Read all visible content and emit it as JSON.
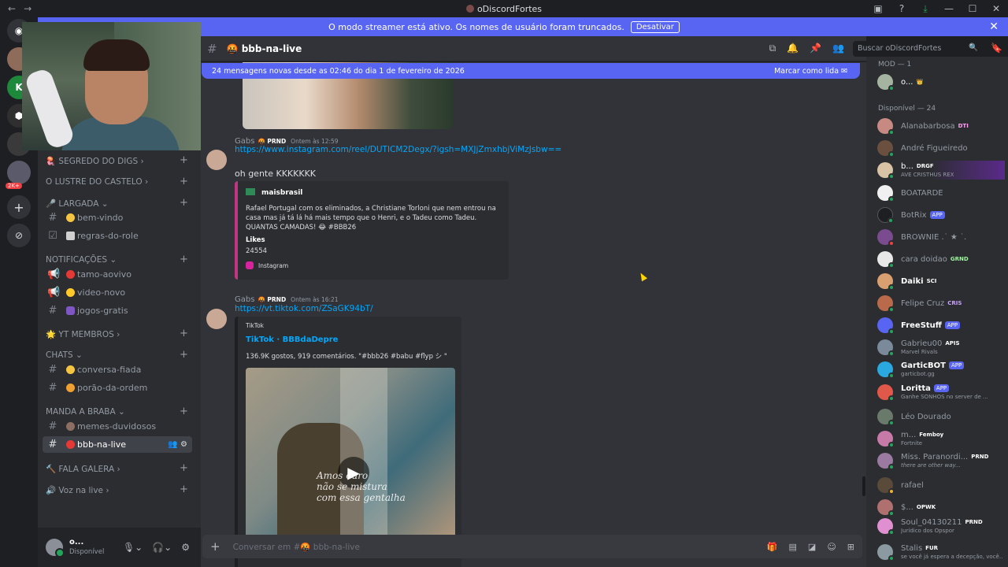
{
  "window": {
    "title": "oDiscordFortes"
  },
  "banner": {
    "text": "O modo streamer está ativo. Os nomes de usuário foram truncados.",
    "button": "Desativar"
  },
  "rail": {
    "badge": "2K+"
  },
  "sidebar": {
    "categories": [
      {
        "label": "SEGREDO DO DIGS ›"
      },
      {
        "label": "O LUSTRE DO CASTELO ›"
      },
      {
        "label": "LARGADA ⌄"
      },
      {
        "label": "NOTIFICAÇÕES ⌄"
      },
      {
        "label": "YT MEMBROS ›"
      },
      {
        "label": "CHATS ⌄"
      },
      {
        "label": "MANDA A BRABA ⌄"
      },
      {
        "label": "FALA GALERA ›"
      },
      {
        "label": "Voz na live ›"
      }
    ],
    "channels": [
      {
        "label": "bem-vindo"
      },
      {
        "label": "regras-do-role"
      },
      {
        "label": "tamo-aovivo"
      },
      {
        "label": "video-novo"
      },
      {
        "label": "jogos-gratis"
      },
      {
        "label": "conversa-fiada"
      },
      {
        "label": "porão-da-ordem"
      },
      {
        "label": "memes-duvidosos"
      },
      {
        "label": "bbb-na-live"
      }
    ]
  },
  "user": {
    "name": "o...",
    "status": "Disponível"
  },
  "header": {
    "channel": "bbb-na-live",
    "search_placeholder": "Buscar oDiscordFortes"
  },
  "newbar": {
    "text": "24 mensagens novas desde as 02:46 do dia 1 de fevereiro de 2026",
    "mark": "Marcar como lida"
  },
  "messages": {
    "m1": {
      "author": "Gabs",
      "tag": "PRND",
      "time": "Ontem às 12:59",
      "link": "https://www.instagram.com/reel/DUTICM2Degx/?igsh=MXJjZmxhbjViMzJsbw=="
    },
    "m2": {
      "text": "oh gente KKKKKKK"
    },
    "embed1": {
      "author": "maisbrasil",
      "body": "Rafael Portugal com os eliminados, a Christiane Torloni que nem entrou na casa mas já tá lá há mais tempo que o Henri, e o Tadeu como Tadeu. QUANTAS CAMADAS! 😂 #BBB26",
      "likes_label": "Likes",
      "likes": "24554",
      "footer": "Instagram"
    },
    "m3": {
      "author": "Gabs",
      "tag": "PRND",
      "time": "Ontem às 16:21",
      "link": "https://vt.tiktok.com/ZSaGK94bT/"
    },
    "embed2": {
      "provider": "TikTok",
      "title": "TikTok · BBBdaDepre",
      "desc": "136.9K gostos, 919 comentários. \"#bbb26 #babu #flyp シ \""
    },
    "video_caption": "Amos ouro\nnão se mistura\ncom essa gentalha"
  },
  "composer": {
    "placeholder": "Conversar em #🤬 bbb-na-live"
  },
  "members": {
    "mod_label": "MOD — 1",
    "online_label": "Disponível — 24",
    "list": [
      {
        "name": "o...",
        "badge": "👑",
        "sub": ""
      },
      {
        "name": "Alanabarbosa",
        "badge": "DTI",
        "sub": ""
      },
      {
        "name": "André Figueiredo",
        "badge": "",
        "sub": ""
      },
      {
        "name": "b...",
        "badge": "DRGF",
        "sub": "AVE CRISTHUS REX"
      },
      {
        "name": "BOATARDE",
        "badge": "",
        "sub": ""
      },
      {
        "name": "BotRix",
        "badge": "APP",
        "sub": ""
      },
      {
        "name": "BROWNIE .˙ ★ ˙.",
        "badge": "",
        "sub": ""
      },
      {
        "name": "cara doidao",
        "badge": "GRND",
        "sub": ""
      },
      {
        "name": "Daiki",
        "badge": "SCI",
        "sub": ""
      },
      {
        "name": "Felipe Cruz",
        "badge": "CRIS",
        "sub": ""
      },
      {
        "name": "FreeStuff",
        "badge": "APP",
        "sub": ""
      },
      {
        "name": "Gabrieu00",
        "badge": "APIS",
        "sub": "Marvel Rivals"
      },
      {
        "name": "GarticBOT",
        "badge": "APP",
        "sub": "garticbot.gg"
      },
      {
        "name": "Loritta",
        "badge": "APP",
        "sub": "Ganhe SONHOS no server de ..."
      },
      {
        "name": "Léo Dourado",
        "badge": "",
        "sub": ""
      },
      {
        "name": "m...",
        "badge": "Femboy",
        "sub": "Fortnite"
      },
      {
        "name": "Miss. Paranordi...",
        "badge": "PRND",
        "sub": "there are other way..."
      },
      {
        "name": "rafael",
        "badge": "",
        "sub": ""
      },
      {
        "name": "$...",
        "badge": "OPWK",
        "sub": ""
      },
      {
        "name": "Soul_04130211",
        "badge": "PRND",
        "sub": "Jurídico dos Opspor"
      },
      {
        "name": "Stalis",
        "badge": "FUR",
        "sub": "se você já espera a decepção, você..."
      }
    ]
  },
  "colors": {
    "accent": "#5865f2",
    "link": "#00a8fc",
    "online": "#23a55a"
  }
}
